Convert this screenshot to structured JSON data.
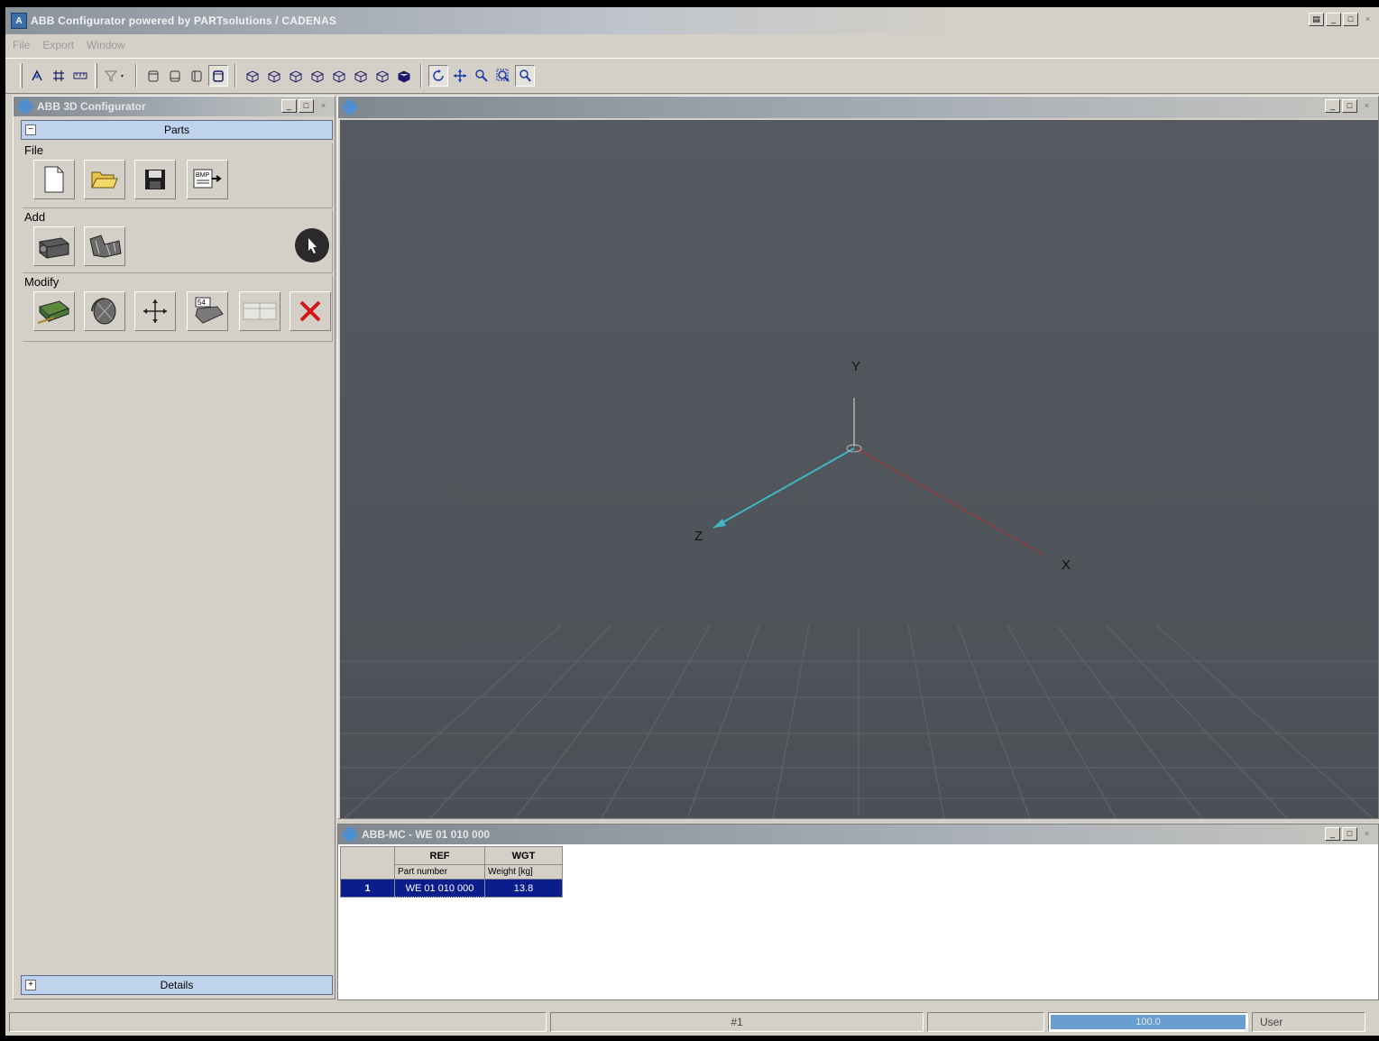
{
  "window": {
    "title": "ABB Configurator powered by PARTsolutions / CADENAS",
    "icon": "app-icon"
  },
  "menu": [
    "File",
    "Export",
    "Window"
  ],
  "toolbar": {
    "icons": [
      "view-rotate-icon",
      "grid-icon",
      "ruler-icon",
      "filter-icon",
      "cube-front-icon",
      "cube-back-icon",
      "cube-left-icon",
      "cube-right-icon",
      "iso-view-icon",
      "rotate-icon",
      "pan-icon",
      "zoom-icon",
      "zoom-window-icon",
      "zoom-fit-icon"
    ]
  },
  "left_panel": {
    "title": "ABB 3D Configurator",
    "parts_header": "Parts",
    "details_header": "Details",
    "groups": {
      "file": "File",
      "add": "Add",
      "modify": "Modify"
    }
  },
  "viewport": {
    "axis_labels": {
      "x": "X",
      "y": "Y",
      "z": "Z"
    },
    "colors": {
      "x": "#b03030",
      "y": "#c8c8c8",
      "z": "#3fb7c4",
      "background": "#53595e"
    }
  },
  "table_window": {
    "title": "ABB-MC - WE 01 010 000",
    "columns": [
      {
        "code": "REF",
        "label": "Part number"
      },
      {
        "code": "WGT",
        "label": "Weight [kg]"
      }
    ],
    "rows": [
      {
        "index": "1",
        "ref": "WE 01 010 000",
        "wgt": "13.8"
      }
    ]
  },
  "statusbar": {
    "page": "#1",
    "progress_value": "100.0",
    "progress_fraction": 1.0,
    "user": "User",
    "progress_color": "#6a9ed0"
  }
}
